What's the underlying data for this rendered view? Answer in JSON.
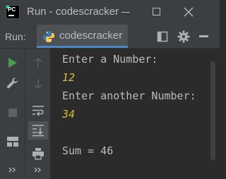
{
  "window": {
    "title": "Run - codescracker"
  },
  "run_panel": {
    "label": "Run:",
    "tab_label": "codescracker"
  },
  "console": {
    "lines": [
      {
        "text": "Enter a Number:",
        "kind": "output"
      },
      {
        "text": "12",
        "kind": "input"
      },
      {
        "text": "Enter another Number:",
        "kind": "output"
      },
      {
        "text": "34",
        "kind": "input"
      },
      {
        "text": "",
        "kind": "output"
      },
      {
        "text": "Sum = 46",
        "kind": "output"
      }
    ]
  },
  "icons": {
    "app": "pycharm-logo-icon",
    "tab": "python-icon",
    "run": "run-icon",
    "wrench": "wrench-icon",
    "stop": "stop-icon",
    "layout": "layout-icon",
    "more": "double-chevron-icon",
    "up": "arrow-up-icon",
    "down": "arrow-down-icon",
    "wrap": "soft-wrap-icon",
    "scroll_end": "scroll-to-end-icon",
    "print": "print-icon",
    "gear": "gear-icon"
  },
  "colors": {
    "background": "#2b2b2b",
    "chrome": "#3c3f41",
    "output_text": "#bbbbbb",
    "input_text": "#d7ba3d",
    "run_green": "#499c54",
    "tab_underline": "#4a88c7"
  }
}
